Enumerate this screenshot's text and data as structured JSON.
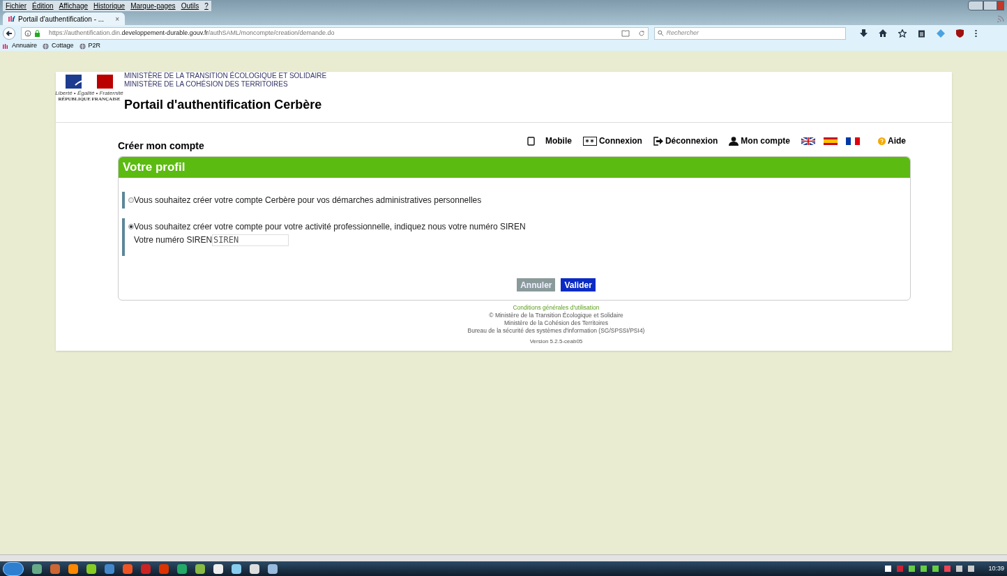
{
  "browser": {
    "menu": [
      "Fichier",
      "Édition",
      "Affichage",
      "Historique",
      "Marque-pages",
      "Outils",
      "?"
    ],
    "tab": {
      "title": "Portail d'authentification - ...",
      "close": "×"
    },
    "url": {
      "host_before": "https://authentification.din.",
      "host_main": "developpement-durable.gouv.fr",
      "path": "/authSAML/moncompte/creation/demande.do"
    },
    "search": {
      "placeholder": "Rechercher"
    },
    "bookmarks": [
      "Annuaire",
      "Cottage",
      "P2R"
    ]
  },
  "header": {
    "logo_motto": "Liberté • Égalité • Fraternité",
    "logo_text": "RÉPUBLIQUE FRANÇAISE",
    "ministries": [
      "MINISTÈRE DE LA TRANSITION ÉCOLOGIQUE ET SOLIDAIRE",
      "MINISTÈRE DE LA COHÉSION DES TERRITOIRES"
    ],
    "title": "Portail d'authentification Cerbère"
  },
  "nav": [
    {
      "kind": "mobile",
      "label": "Mobile"
    },
    {
      "kind": "login",
      "label": "Connexion"
    },
    {
      "kind": "logout",
      "label": "Déconnexion"
    },
    {
      "kind": "account",
      "label": "Mon compte"
    },
    {
      "kind": "flags"
    },
    {
      "kind": "help",
      "label": "Aide"
    }
  ],
  "heading": "Créer mon compte",
  "panel": {
    "title": "Votre profil",
    "options": [
      {
        "label": "Vous souhaitez créer votre compte Cerbère pour vos démarches administratives personnelles",
        "selected": false
      },
      {
        "label": "Vous souhaitez créer votre compte pour votre activité professionnelle, indiquez nous votre numéro SIREN",
        "selected": true,
        "field": {
          "label": "Votre numéro SIREN",
          "placeholder": "SIREN"
        }
      }
    ],
    "buttons": [
      {
        "label": "Annuler",
        "kind": "secondary"
      },
      {
        "label": "Valider",
        "kind": "primary"
      }
    ]
  },
  "footer": {
    "link": "Conditions générales d'utilisation",
    "lines": [
      "© Ministère de la Transition Écologique et Solidaire",
      "Ministère de la Cohésion des Territoires",
      "Bureau de la sécurité des systèmes d'information (SG/SPSSI/PSI4)"
    ],
    "version": "Version 5.2.5-ceab05"
  },
  "taskbar": {
    "clock": "10:39"
  }
}
